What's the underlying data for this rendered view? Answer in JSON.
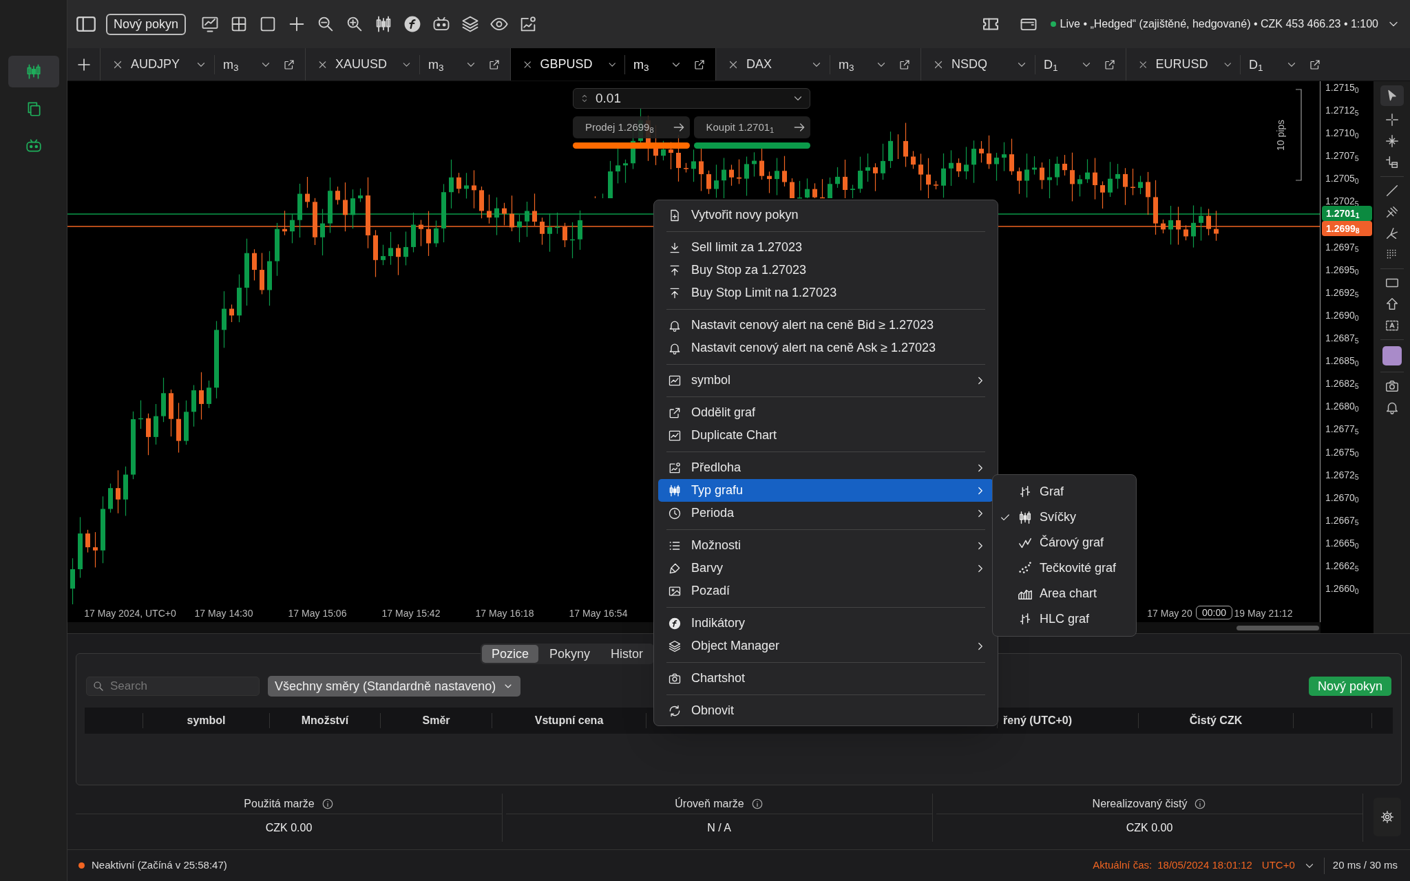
{
  "sidebar": {
    "items": [
      {
        "kind": "chart",
        "selected": true
      },
      {
        "kind": "copy",
        "selected": false
      },
      {
        "kind": "robot",
        "selected": false
      }
    ]
  },
  "toolbar": {
    "new_order": "Nový pokyn",
    "account": "Live • „Hedged“ (zajištěné, hedgované) • CZK 453 466.23 • 1:100"
  },
  "chart_tabs": [
    {
      "symbol": "AUDJPY",
      "period": "m$_{3}$",
      "selected": false
    },
    {
      "symbol": "XAUUSD",
      "period": "m$_{3}$",
      "selected": false
    },
    {
      "symbol": "GBPUSD",
      "period": "m$_{3}$",
      "selected": true
    },
    {
      "symbol": "DAX",
      "period": "m$_{3}$",
      "selected": false
    },
    {
      "symbol": "NSDQ",
      "period": "D$_{1}$",
      "selected": false
    },
    {
      "symbol": "EURUSD",
      "period": "D$_{1}$",
      "selected": false
    }
  ],
  "order_panel": {
    "volume": "0.01",
    "sell": "Prodej 1.2699$_{8}$",
    "buy": "Koupit 1.2701$_{1}$"
  },
  "chart": {
    "pips_label": "10 pips",
    "price_labels_upper": [
      "1.2715$_{0}$",
      "1.2712$_{5}$",
      "1.2710$_{0}$",
      "1.2707$_{5}$",
      "1.2705$_{0}$",
      "1.2702$_{5}$"
    ],
    "price_labels_lower": [
      "1.2697$_{5}$",
      "1.2695$_{0}$",
      "1.2692$_{5}$",
      "1.2690$_{0}$",
      "1.2687$_{5}$",
      "1.2685$_{0}$",
      "1.2682$_{5}$",
      "1.2680$_{0}$",
      "1.2677$_{5}$",
      "1.2675$_{0}$",
      "1.2672$_{5}$",
      "1.2670$_{0}$",
      "1.2667$_{5}$",
      "1.2665$_{0}$",
      "1.2662$_{5}$",
      "1.2660$_{0}$"
    ],
    "ask_label": "1.2701$_{1}$",
    "bid_label": "1.2699$_{8}$",
    "time_labels_left": [
      "17 May 2024, UTC+0",
      "17 May 14:30",
      "17 May 15:06",
      "17 May 15:42",
      "17 May 16:18",
      "17 May 16:54"
    ],
    "time_labels_right": [
      "17 May 20",
      "19 May 21:12"
    ],
    "cursor_time": "00:00"
  },
  "context_menu": {
    "items": [
      {
        "kind": "item",
        "label": "Vytvořit novy pokyn",
        "submenu": false,
        "selected": false
      },
      {
        "kind": "separator"
      },
      {
        "kind": "item",
        "label": "Sell limit za 1.27023",
        "submenu": false,
        "selected": false
      },
      {
        "kind": "item",
        "label": "Buy Stop za 1.27023",
        "submenu": false,
        "selected": false
      },
      {
        "kind": "item",
        "label": "Buy Stop Limit na 1.27023",
        "submenu": false,
        "selected": false
      },
      {
        "kind": "separator"
      },
      {
        "kind": "item",
        "label": "Nastavit cenový alert na ceně Bid ≥ 1.27023",
        "submenu": false,
        "selected": false
      },
      {
        "kind": "item",
        "label": "Nastavit cenový alert na ceně Ask ≥ 1.27023",
        "submenu": false,
        "selected": false
      },
      {
        "kind": "separator"
      },
      {
        "kind": "item",
        "label": "symbol",
        "submenu": true,
        "selected": false
      },
      {
        "kind": "separator"
      },
      {
        "kind": "item",
        "label": "Oddělit graf",
        "submenu": false,
        "selected": false
      },
      {
        "kind": "item",
        "label": "Duplicate Chart",
        "submenu": false,
        "selected": false
      },
      {
        "kind": "separator"
      },
      {
        "kind": "item",
        "label": "Předloha",
        "submenu": true,
        "selected": false
      },
      {
        "kind": "item",
        "label": "Typ grafu",
        "submenu": true,
        "selected": true
      },
      {
        "kind": "item",
        "label": "Perioda",
        "submenu": true,
        "selected": false
      },
      {
        "kind": "separator"
      },
      {
        "kind": "item",
        "label": "Možnosti",
        "submenu": true,
        "selected": false
      },
      {
        "kind": "item",
        "label": "Barvy",
        "submenu": true,
        "selected": false
      },
      {
        "kind": "item",
        "label": "Pozadí",
        "submenu": false,
        "selected": false
      },
      {
        "kind": "separator"
      },
      {
        "kind": "item",
        "label": "Indikátory",
        "submenu": false,
        "selected": false
      },
      {
        "kind": "item",
        "label": "Object Manager",
        "submenu": true,
        "selected": false
      },
      {
        "kind": "separator"
      },
      {
        "kind": "item",
        "label": "Chartshot",
        "submenu": false,
        "selected": false
      },
      {
        "kind": "separator"
      },
      {
        "kind": "item",
        "label": "Obnovit",
        "submenu": false,
        "selected": false
      }
    ]
  },
  "chart_type_menu": {
    "items": [
      {
        "label": "Graf",
        "checked": false
      },
      {
        "label": "Svíčky",
        "checked": true
      },
      {
        "label": "Čárový graf",
        "checked": false
      },
      {
        "label": "Tečkovité graf",
        "checked": false
      },
      {
        "label": "Area chart",
        "checked": false
      },
      {
        "label": "HLC graf",
        "checked": false
      }
    ]
  },
  "positions_panel": {
    "tabs": [
      {
        "label": "Pozice",
        "selected": true
      },
      {
        "label": "Pokyny",
        "selected": false
      },
      {
        "label": "Histor",
        "selected": false
      }
    ],
    "search": {
      "placeholder": "Search"
    },
    "filter": "Všechny směry (Standardně nastaveno)",
    "new_order": "Nový pokyn",
    "columns": [
      "symbol",
      "Množství",
      "Směr",
      "Vstupní cena",
      "řený (UTC+0)",
      "Čistý CZK"
    ]
  },
  "summary": [
    {
      "label": "Použitá marže",
      "value": "CZK 0.00"
    },
    {
      "label": "Úroveň marže",
      "value": "N / A"
    },
    {
      "label": "Nerealizovaný čistý",
      "value": "CZK 0.00"
    }
  ],
  "status_bar": {
    "connection": "Neaktivní (Začíná v 25:58:47)",
    "time_label": "Aktuální čas:",
    "time": "18/05/2024 18:01:12",
    "timezone": "UTC+0",
    "latency": "20 ms / 30 ms"
  }
}
